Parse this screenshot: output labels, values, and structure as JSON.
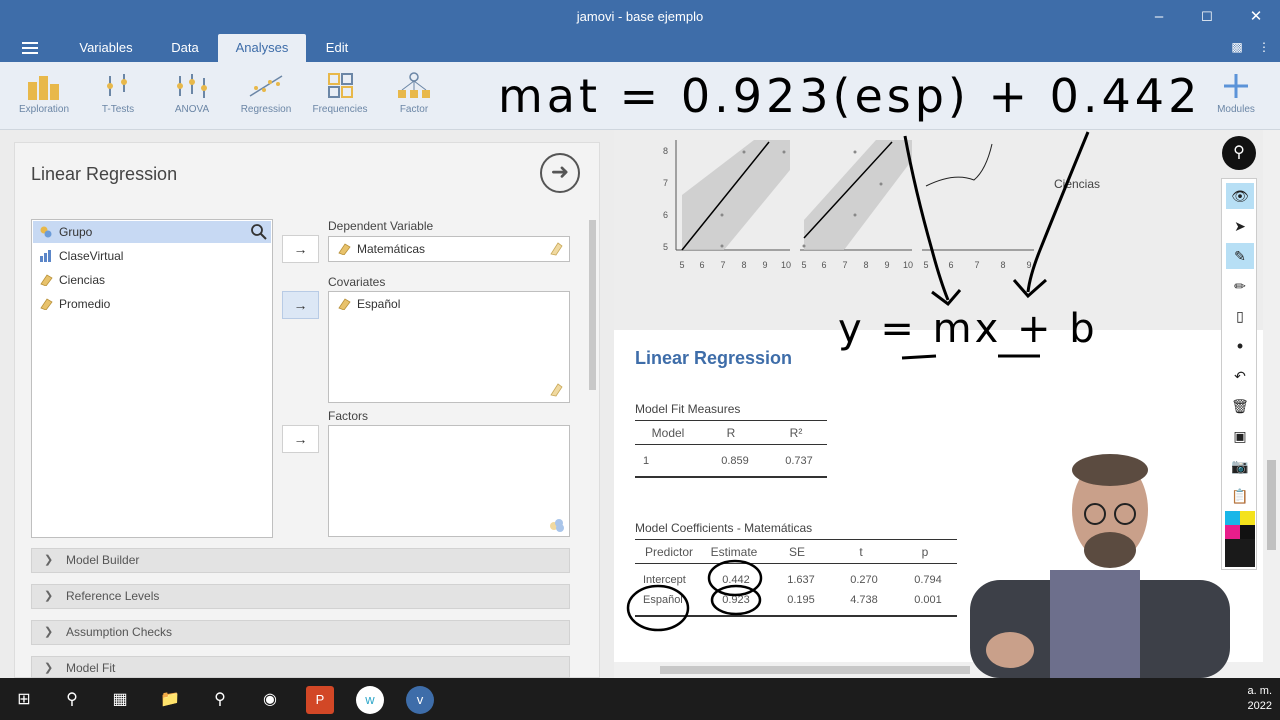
{
  "window": {
    "title": "jamovi - base ejemplo"
  },
  "menu": {
    "tabs": [
      "Variables",
      "Data",
      "Analyses",
      "Edit"
    ],
    "active": "Analyses"
  },
  "ribbon": {
    "items": [
      "Exploration",
      "T-Tests",
      "ANOVA",
      "Regression",
      "Frequencies",
      "Factor"
    ],
    "modules": "Modules"
  },
  "options": {
    "title": "Linear Regression",
    "variables": [
      "Grupo",
      "ClaseVirtual",
      "Ciencias",
      "Promedio"
    ],
    "dependent_label": "Dependent Variable",
    "dependent_value": "Matemáticas",
    "covariates_label": "Covariates",
    "covariates": [
      "Español"
    ],
    "factors_label": "Factors",
    "sections": [
      "Model Builder",
      "Reference Levels",
      "Assumption Checks",
      "Model Fit"
    ]
  },
  "plots": {
    "y_ticks": [
      "8",
      "7",
      "6",
      "5"
    ],
    "x_ticks_1": [
      "5",
      "6",
      "7",
      "8",
      "9",
      "10"
    ],
    "x_ticks_2": [
      "5",
      "6",
      "7",
      "8",
      "9",
      "10"
    ],
    "x_ticks_3": [
      "5",
      "6",
      "7",
      "8",
      "9"
    ],
    "panel3_label": "Ciencias"
  },
  "results": {
    "title": "Linear Regression",
    "fit": {
      "caption": "Model Fit Measures",
      "headers": [
        "Model",
        "R",
        "R²"
      ],
      "row": [
        "1",
        "0.859",
        "0.737"
      ]
    },
    "coef": {
      "caption": "Model Coefficients - Matemáticas",
      "headers": [
        "Predictor",
        "Estimate",
        "SE",
        "t",
        "p"
      ],
      "rows": [
        [
          "Intercept",
          "0.442",
          "1.637",
          "0.270",
          "0.794"
        ],
        [
          "Español",
          "0.923",
          "0.195",
          "4.738",
          "0.001"
        ]
      ]
    }
  },
  "annotations": {
    "equation": "mat = 0.923(esp) + 0.442",
    "formula": "y = mx + b"
  },
  "taskbar": {
    "clock_line1": "a. m.",
    "clock_line2": "2022"
  }
}
